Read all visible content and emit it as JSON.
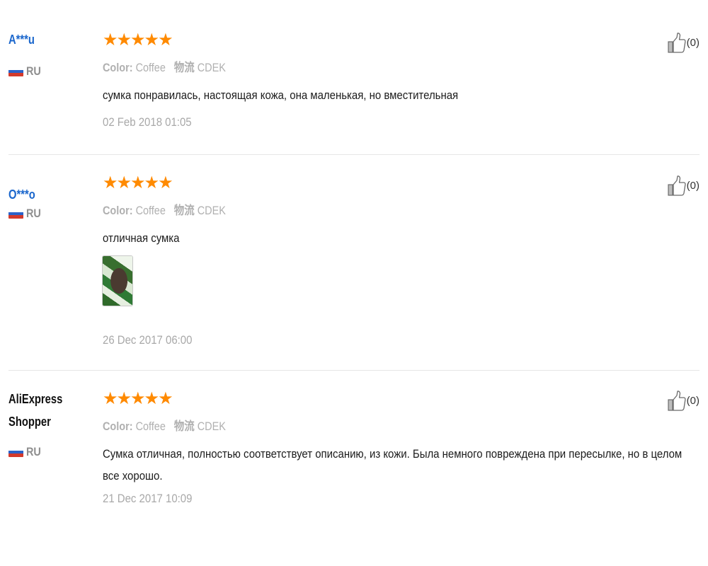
{
  "reviews": [
    {
      "user": "A***u",
      "country": "RU",
      "rating_stars": "★★★★★",
      "rating": 5,
      "color_label": "Color:",
      "color_value": "Coffee",
      "shipping_label": "物流",
      "shipping_value": "CDEK",
      "text": "сумка понравилась, настоящая кожа, она маленькая, но вместительная",
      "date": "02 Feb 2018 01:05",
      "likes": "(0)"
    },
    {
      "user": "O***o",
      "country": "RU",
      "rating_stars": "★★★★★",
      "rating": 5,
      "color_label": "Color:",
      "color_value": "Coffee",
      "shipping_label": "物流",
      "shipping_value": "CDEK",
      "text": "отличная сумка",
      "date": "26 Dec 2017 06:00",
      "likes": "(0)"
    },
    {
      "user": "AliExpress Shopper",
      "country": "RU",
      "rating_stars": "★★★★★",
      "rating": 5,
      "color_label": "Color:",
      "color_value": "Coffee",
      "shipping_label": "物流",
      "shipping_value": "CDEK",
      "text": "Сумка отличная, полностью соответствует описанию, из кожи. Была немного повреждена при пересылке, но в целом все хорошо.",
      "date": "21 Dec 2017 10:09",
      "likes": "(0)"
    }
  ],
  "icons": {
    "like": "thumbs-up-icon",
    "flag": "russia-flag-icon"
  },
  "colors": {
    "user_link": "#1a66cc",
    "stars": "#ff8a00",
    "muted": "#b0b0b0"
  }
}
